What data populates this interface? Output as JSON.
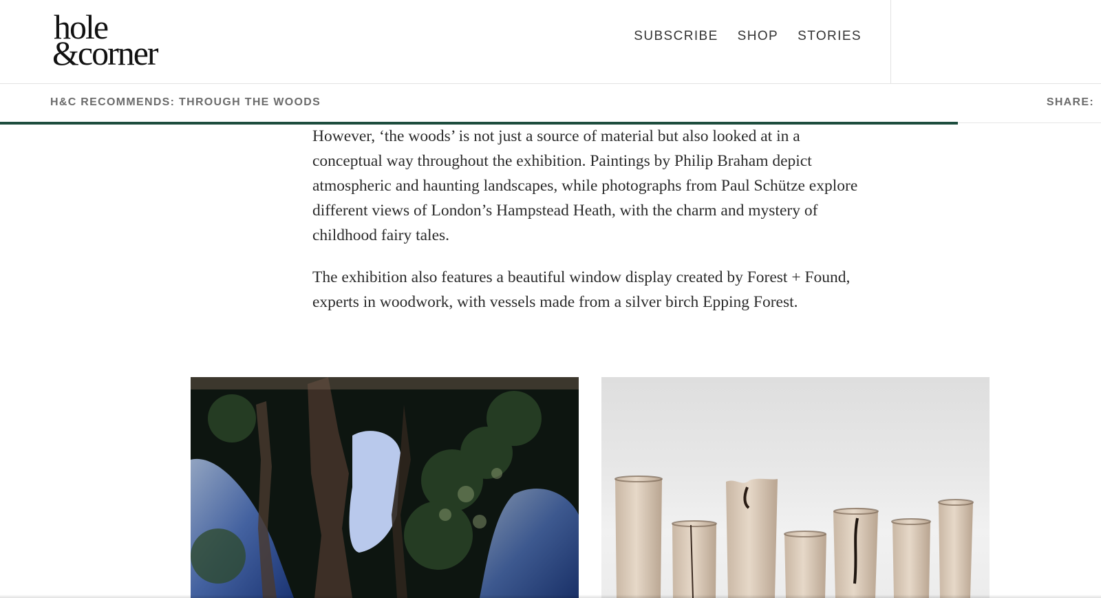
{
  "header": {
    "logo_line1": "hole",
    "logo_line2": "&corner",
    "nav": [
      {
        "label": "SUBSCRIBE"
      },
      {
        "label": "SHOP"
      },
      {
        "label": "STORIES"
      }
    ]
  },
  "subbar": {
    "title": "H&C RECOMMENDS: THROUGH THE WOODS",
    "share": "SHARE:",
    "read_progress": 0.87
  },
  "article": {
    "paragraphs": [
      "However, ‘the woods’ is not just a source of material but also looked at in a conceptual way throughout the exhibition. Paintings by Philip Braham depict atmospheric and haunting landscapes, while photographs from Paul Schütze explore different views of London’s Hampstead Heath, with the charm and mystery of childhood fairy tales.",
      "The exhibition also features a beautiful window display created by Forest + Found, experts in woodwork, with vessels made from a silver birch Epping Forest."
    ]
  },
  "colors": {
    "accent": "#1d4d3e",
    "nav_text": "#333333",
    "subbar_text": "#6b6b6b",
    "body_text": "#2a2a2a"
  }
}
